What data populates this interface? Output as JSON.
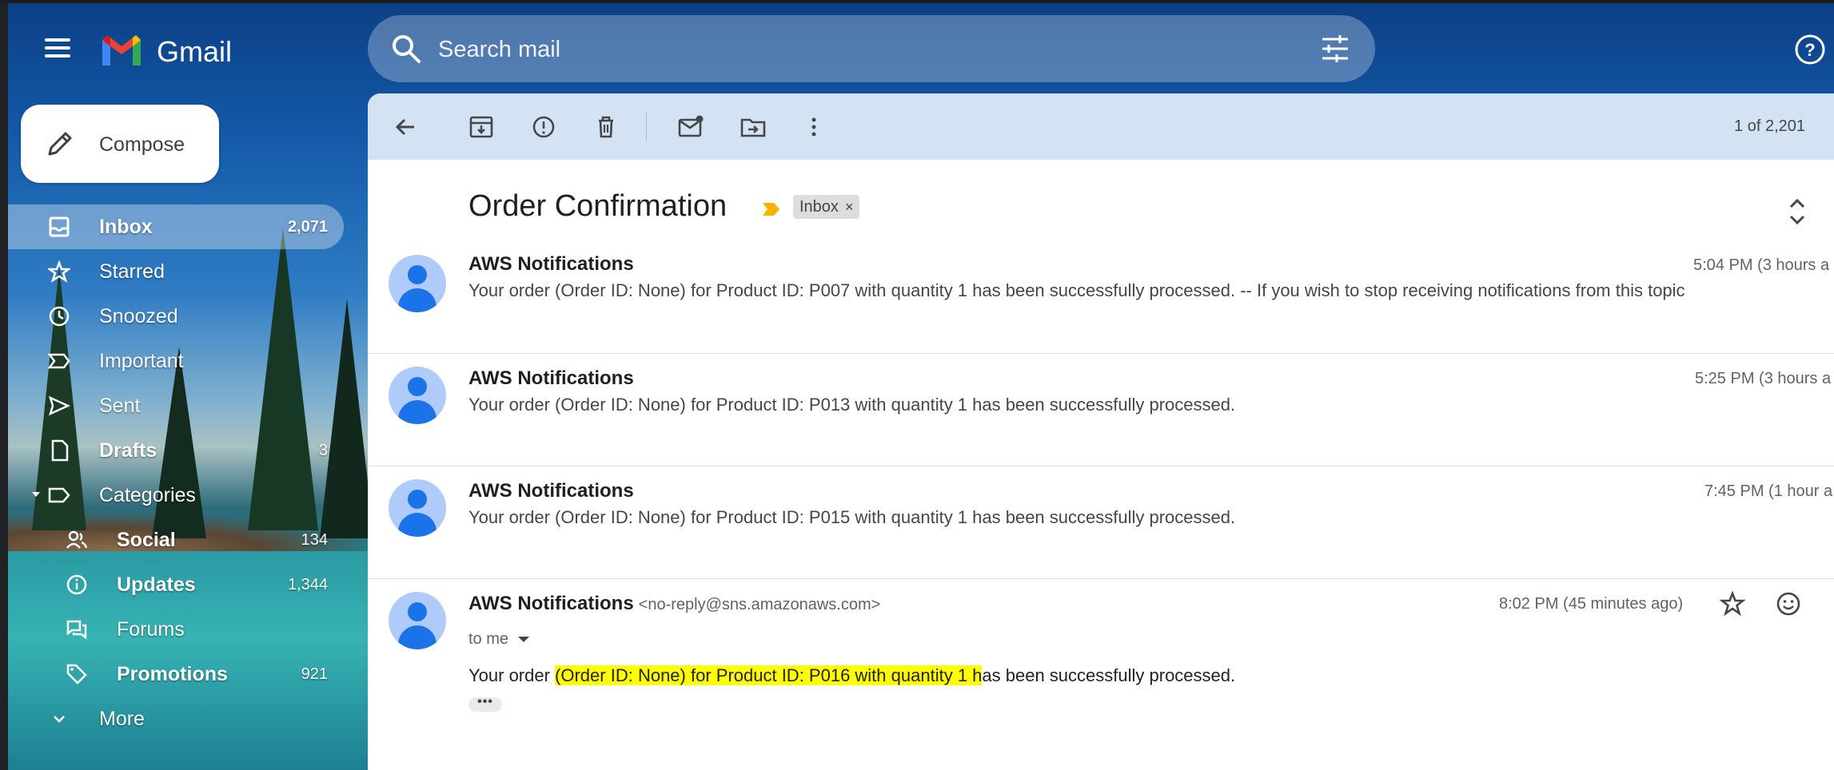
{
  "app": {
    "brand": "Gmail"
  },
  "search": {
    "placeholder": "Search mail"
  },
  "compose": {
    "label": "Compose"
  },
  "sidebar": {
    "items": [
      {
        "label": "Inbox",
        "count": "2,071",
        "icon": "inbox-icon"
      },
      {
        "label": "Starred",
        "count": "",
        "icon": "star-icon"
      },
      {
        "label": "Snoozed",
        "count": "",
        "icon": "clock-icon"
      },
      {
        "label": "Important",
        "count": "",
        "icon": "important-icon"
      },
      {
        "label": "Sent",
        "count": "",
        "icon": "send-icon"
      },
      {
        "label": "Drafts",
        "count": "3",
        "icon": "draft-icon"
      },
      {
        "label": "Categories",
        "count": "",
        "icon": "label-icon"
      },
      {
        "label": "Social",
        "count": "134",
        "icon": "people-icon"
      },
      {
        "label": "Updates",
        "count": "1,344",
        "icon": "info-icon"
      },
      {
        "label": "Forums",
        "count": "",
        "icon": "forum-icon"
      },
      {
        "label": "Promotions",
        "count": "921",
        "icon": "tag-icon"
      },
      {
        "label": "More",
        "count": "",
        "icon": "chevron-down-icon"
      }
    ]
  },
  "toolbar": {
    "pager": "1 of 2,201"
  },
  "thread": {
    "subject": "Order Confirmation",
    "label_chip": "Inbox",
    "label_chip_close": "×",
    "messages": [
      {
        "sender": "AWS Notifications",
        "time": "5:04 PM (3 hours a",
        "snippet": "Your order (Order ID: None) for Product ID: P007 with quantity 1 has been successfully processed. -- If you wish to stop receiving notifications from this topic"
      },
      {
        "sender": "AWS Notifications",
        "time": "5:25 PM (3 hours a",
        "snippet": "Your order (Order ID: None) for Product ID: P013 with quantity 1 has been successfully processed."
      },
      {
        "sender": "AWS Notifications",
        "time": "7:45 PM (1 hour a",
        "snippet": "Your order (Order ID: None) for Product ID: P015 with quantity 1 has been successfully processed."
      }
    ],
    "open_message": {
      "sender": "AWS Notifications",
      "email": "<no-reply@sns.amazonaws.com>",
      "time": "8:02 PM (45 minutes ago)",
      "to": "to me",
      "body_pre": "Your order ",
      "body_highlight": "(Order ID: None) for Product ID: P016 with quantity 1 h",
      "body_post": "as been successfully processed.",
      "trimmed": "•••"
    }
  },
  "colors": {
    "toolbar_bg": "#d3e3f3",
    "highlight": "#ffff00",
    "avatar_bg": "#aecbfa",
    "avatar_fg": "#1a73e8"
  }
}
